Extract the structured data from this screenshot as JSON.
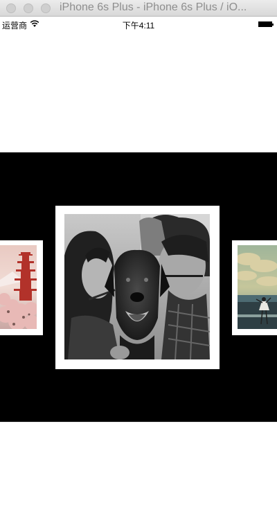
{
  "window": {
    "title": "iPhone 6s Plus - iPhone 6s Plus / iO..."
  },
  "status_bar": {
    "carrier": "运营商",
    "time": "下午4:11",
    "wifi_icon": "wifi-icon",
    "battery_icon": "battery-icon"
  },
  "carousel": {
    "background": "#000000",
    "items": [
      {
        "subject": "pagoda-photo"
      },
      {
        "subject": "couple-with-dog-photo"
      },
      {
        "subject": "girl-dancing-on-beach-photo"
      }
    ]
  }
}
